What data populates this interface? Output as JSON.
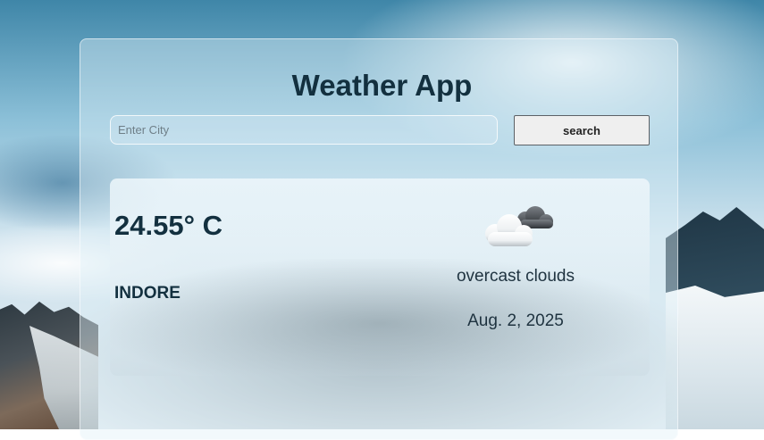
{
  "app": {
    "title": "Weather App"
  },
  "search": {
    "placeholder": "Enter City",
    "value": "",
    "button_label": "search"
  },
  "weather": {
    "temperature": "24.55° C",
    "city": "INDORE",
    "description": "overcast clouds",
    "date": "Aug. 2, 2025",
    "icon": "overcast-cloud-icon"
  },
  "colors": {
    "title_text": "#13303f",
    "button_bg": "#efefef",
    "button_border": "#5c6166"
  }
}
